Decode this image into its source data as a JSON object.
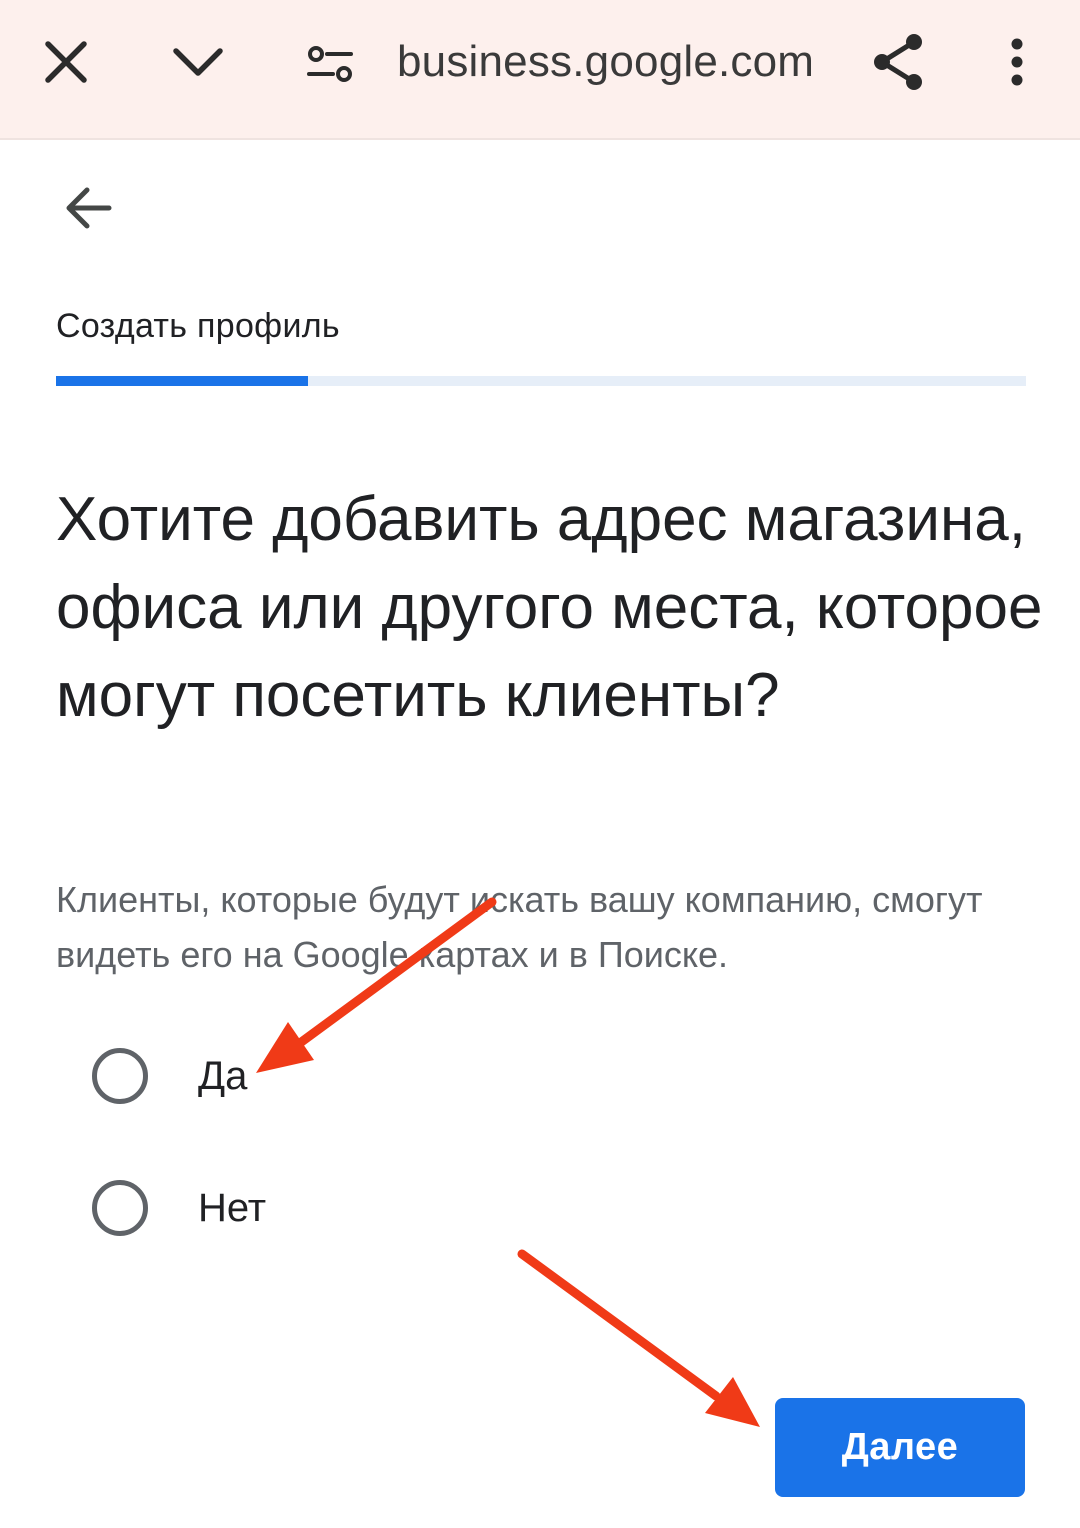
{
  "browser": {
    "url": "business.google.com",
    "icons": [
      "close-icon",
      "chevron-down-icon",
      "tune-icon",
      "share-icon",
      "more-vert-icon"
    ]
  },
  "page": {
    "step_label": "Создать профиль",
    "progress_fraction": 0.26,
    "question": "Хотите добавить адрес магазина, офиса или другого места, которое могут посетить клиенты?",
    "hint": "Клиенты, которые будут искать вашу компанию, смогут видеть его на Google картах и в Поиске.",
    "options": [
      {
        "label": "Да",
        "selected": false
      },
      {
        "label": "Нет",
        "selected": false
      }
    ],
    "next_label": "Далее"
  },
  "colors": {
    "accent": "#1a73e8",
    "topbar_bg": "#fdf0ed",
    "annotation_arrow": "#f03a17"
  }
}
